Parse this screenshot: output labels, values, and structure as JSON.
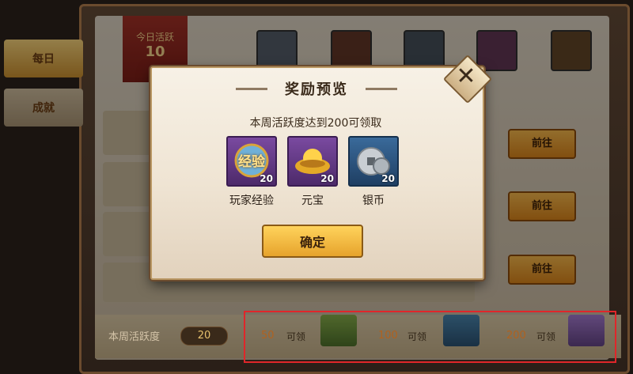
{
  "background": {
    "tabs": [
      {
        "label": "每日"
      },
      {
        "label": "成就"
      }
    ],
    "banner_title": "今日活跃",
    "banner_value": "10",
    "go_label": "前往",
    "weekly_label": "本周活跃度",
    "weekly_value": "20",
    "milestones": [
      {
        "value": "50",
        "label": "可领"
      },
      {
        "value": "100",
        "label": "可领"
      },
      {
        "value": "200",
        "label": "可领"
      }
    ]
  },
  "modal": {
    "title": "奖励预览",
    "subtitle": "本周活跃度达到200可领取",
    "rewards": [
      {
        "name": "玩家经验",
        "count": "20",
        "icon": "exp-icon",
        "badge": "经验"
      },
      {
        "name": "元宝",
        "count": "20",
        "icon": "gold-ingot-icon"
      },
      {
        "name": "银币",
        "count": "20",
        "icon": "silver-coin-icon"
      }
    ],
    "confirm_label": "确定"
  },
  "colors": {
    "highlight": "#e0262a",
    "accent_gold": "#e6a32c",
    "purple_frame": "#7a4aa0",
    "blue_frame": "#3a6a9a"
  }
}
